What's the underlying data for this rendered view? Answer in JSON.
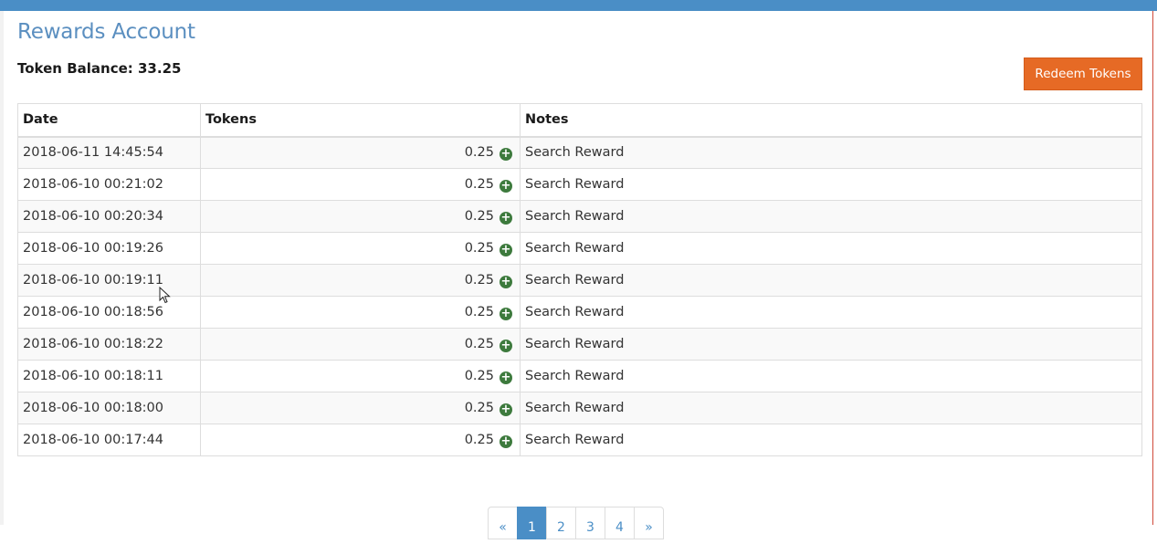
{
  "header": {
    "title": "Rewards Account",
    "balance_label": "Token Balance:",
    "balance_value": "33.25",
    "redeem_label": "Redeem Tokens"
  },
  "colors": {
    "top_bar": "#4a8ec6",
    "accent_button": "#e66a25",
    "plus_icon": "#3d7a3d"
  },
  "table": {
    "columns": [
      "Date",
      "Tokens",
      "Notes"
    ],
    "rows": [
      {
        "date": "2018-06-11 14:45:54",
        "tokens": "0.25",
        "notes": "Search Reward"
      },
      {
        "date": "2018-06-10 00:21:02",
        "tokens": "0.25",
        "notes": "Search Reward"
      },
      {
        "date": "2018-06-10 00:20:34",
        "tokens": "0.25",
        "notes": "Search Reward"
      },
      {
        "date": "2018-06-10 00:19:26",
        "tokens": "0.25",
        "notes": "Search Reward"
      },
      {
        "date": "2018-06-10 00:19:11",
        "tokens": "0.25",
        "notes": "Search Reward"
      },
      {
        "date": "2018-06-10 00:18:56",
        "tokens": "0.25",
        "notes": "Search Reward"
      },
      {
        "date": "2018-06-10 00:18:22",
        "tokens": "0.25",
        "notes": "Search Reward"
      },
      {
        "date": "2018-06-10 00:18:11",
        "tokens": "0.25",
        "notes": "Search Reward"
      },
      {
        "date": "2018-06-10 00:18:00",
        "tokens": "0.25",
        "notes": "Search Reward"
      },
      {
        "date": "2018-06-10 00:17:44",
        "tokens": "0.25",
        "notes": "Search Reward"
      }
    ],
    "row_icon": "plus-circle-icon"
  },
  "pagination": {
    "prev": "«",
    "pages": [
      "1",
      "2",
      "3",
      "4"
    ],
    "next": "»",
    "current": "1"
  }
}
